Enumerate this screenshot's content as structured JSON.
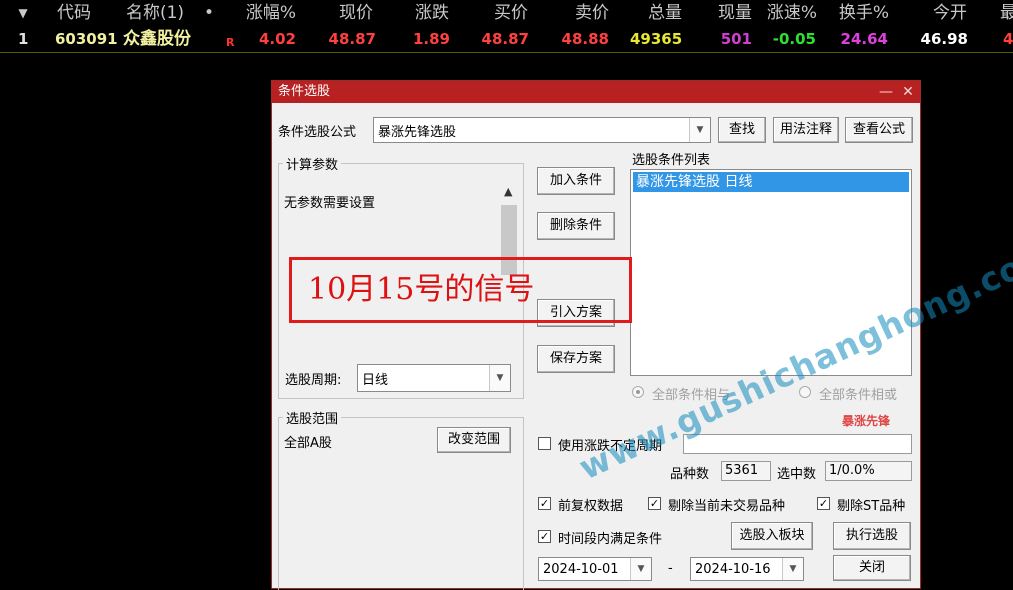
{
  "grid": {
    "sort_arrow": "▼",
    "headers": [
      "代码",
      "名称(1)",
      "•",
      "涨幅%",
      "现价",
      "涨跌",
      "买价",
      "卖价",
      "总量",
      "现量",
      "涨速%",
      "换手%",
      "今开",
      "最"
    ],
    "row": {
      "index": "1",
      "code": "603091",
      "name": "众鑫股份",
      "flag": "R",
      "change_pct": "4.02",
      "price": "48.87",
      "change": "1.89",
      "bid": "48.87",
      "ask": "48.88",
      "volume": "49365",
      "last_vol": "501",
      "speed": "-0.05",
      "turnover": "24.64",
      "open": "46.98",
      "high": "4"
    }
  },
  "dialog": {
    "title": "条件选股",
    "minimize": "—",
    "close": "✕",
    "formula_label": "条件选股公式",
    "formula_value": "暴涨先锋选股",
    "find_btn": "查找",
    "usage_btn": "用法注释",
    "view_btn": "查看公式",
    "params_group": "计算参数",
    "no_params": "无参数需要设置",
    "period_label": "选股周期:",
    "period_value": "日线",
    "add_btn": "加入条件",
    "remove_btn": "删除条件",
    "import_btn": "引入方案",
    "save_btn": "保存方案",
    "list_title": "选股条件列表",
    "list_items": [
      "暴涨先锋选股  日线"
    ],
    "radio_and": "全部条件相与",
    "radio_or": "全部条件相或",
    "scope_group": "选股范围",
    "scope_value": "全部A股",
    "change_scope_btn": "改变范围",
    "uncertain_period": "使用涨跌不定周期",
    "count_label": "品种数",
    "count_value": "5361",
    "selected_label": "选中数",
    "selected_value": "1/0.0%",
    "chk_adjust": "前复权数据",
    "chk_untraded": "剔除当前未交易品种",
    "chk_st": "剔除ST品种",
    "chk_timerange": "时间段内满足条件",
    "to_sector_btn": "选股入板块",
    "run_btn": "执行选股",
    "close_btn": "关闭",
    "date_from": "2024-10-01",
    "date_sep": "-",
    "date_to": "2024-10-16"
  },
  "overlay": {
    "annotation": "10月15号的信号",
    "watermark": "www.gushichanghong.com",
    "stamp": "暴涨先锋"
  },
  "colors": {
    "title_bar": "#b82121",
    "positive": "#ff4040",
    "code": "#f0f0a0",
    "volume": "#e8e830",
    "last_vol": "#d040d0",
    "speed": "#30e030",
    "turnover": "#e040e0",
    "selection": "#3296e6"
  }
}
